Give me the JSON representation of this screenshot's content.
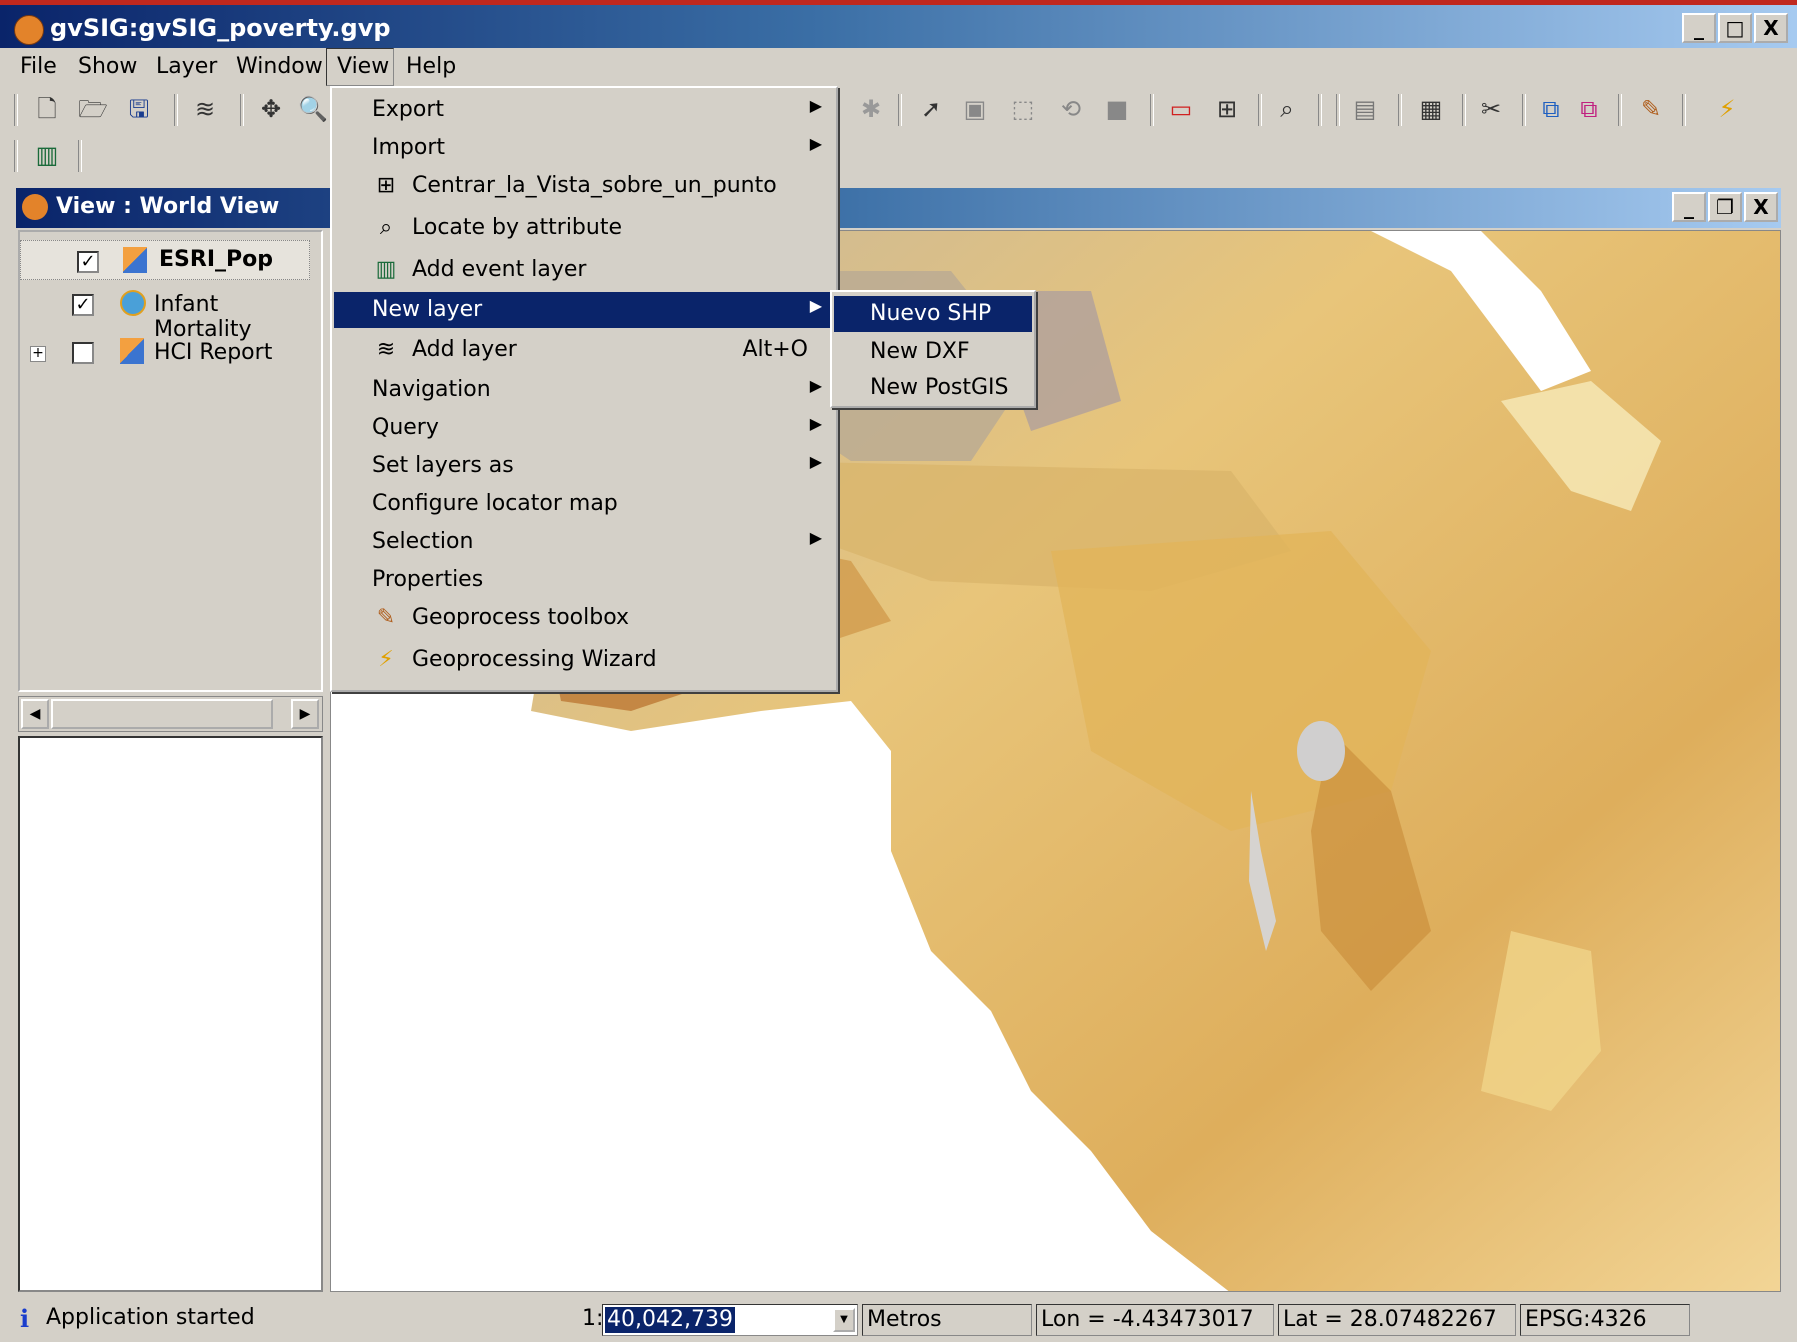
{
  "window": {
    "title": "gvSIG:gvSIG_poverty.gvp",
    "controls": [
      "_",
      "□",
      "X"
    ]
  },
  "menubar": {
    "items": [
      "File",
      "Show",
      "Layer",
      "Window",
      "View",
      "Help"
    ]
  },
  "inner_window": {
    "title": "View : World View",
    "controls": [
      "_",
      "❐",
      "X"
    ]
  },
  "toc": {
    "layers": [
      {
        "name": "ESRI_Pop",
        "checked": true,
        "bold": true
      },
      {
        "name": "Infant Mortality",
        "checked": true,
        "bold": false
      },
      {
        "name": "HCI Report",
        "checked": false,
        "bold": false,
        "expandable": true
      }
    ]
  },
  "view_menu": {
    "items": [
      {
        "label": "Export",
        "submenu": true
      },
      {
        "label": "Import",
        "submenu": true
      },
      {
        "label": "Centrar_la_Vista_sobre_un_punto",
        "icon": "center-view-icon"
      },
      {
        "label": "Locate by attribute",
        "icon": "locate-icon"
      },
      {
        "label": "Add event layer",
        "icon": "event-layer-icon"
      },
      {
        "label": "New layer",
        "submenu": true,
        "selected": true
      },
      {
        "label": "Add layer",
        "icon": "add-layer-icon",
        "accelerator": "Alt+O"
      },
      {
        "label": "Navigation",
        "submenu": true
      },
      {
        "label": "Query",
        "submenu": true
      },
      {
        "label": "Set layers as",
        "submenu": true
      },
      {
        "label": "Configure locator map"
      },
      {
        "label": "Selection",
        "submenu": true
      },
      {
        "label": "Properties"
      },
      {
        "label": "Geoprocess toolbox",
        "icon": "geoprocess-toolbox-icon"
      },
      {
        "label": "Geoprocessing Wizard",
        "icon": "geoprocessing-wizard-icon"
      }
    ]
  },
  "new_layer_submenu": {
    "items": [
      {
        "label": "Nuevo SHP",
        "selected": true
      },
      {
        "label": "New DXF"
      },
      {
        "label": "New PostGIS"
      }
    ]
  },
  "statusbar": {
    "message": "Application started",
    "scale_prefix": "1:",
    "scale_value": "40,042,739",
    "units": "Metros",
    "lon": "Lon = -4.43473017",
    "lat": "Lat = 28.07482267",
    "crs": "EPSG:4326"
  }
}
